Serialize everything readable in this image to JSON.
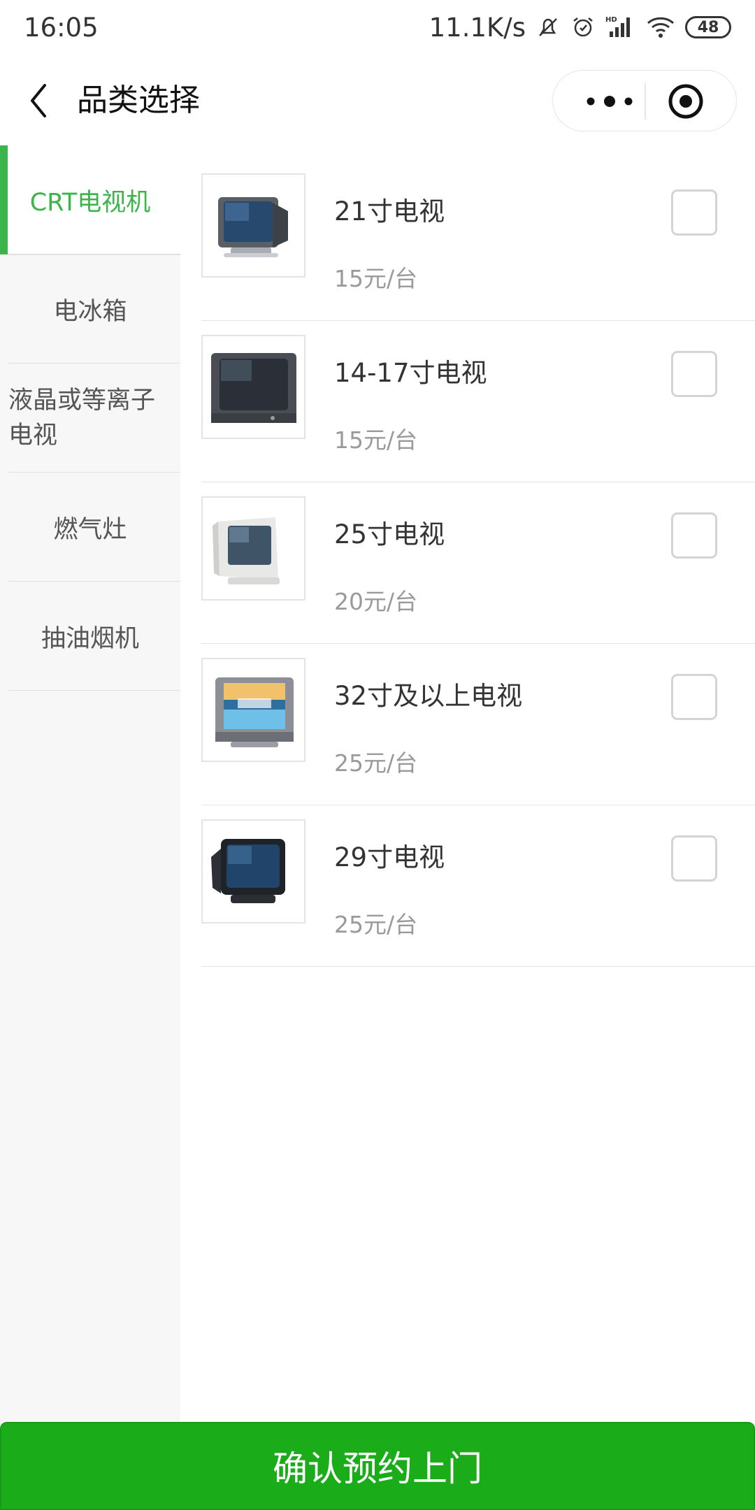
{
  "status_bar": {
    "time": "16:05",
    "network_speed": "11.1K/s",
    "battery": "48",
    "icons": [
      "bell-muted-icon",
      "alarm-icon",
      "hd-signal-icon",
      "wifi-icon",
      "battery-icon"
    ]
  },
  "nav": {
    "title": "品类选择",
    "icons": [
      "back-arrow-icon",
      "more-dots-icon",
      "target-icon"
    ]
  },
  "sidebar": {
    "items": [
      {
        "label": "CRT电视机",
        "active": true
      },
      {
        "label": "电冰箱",
        "active": false
      },
      {
        "label": "液晶或等离子电视",
        "active": false
      },
      {
        "label": "燃气灶",
        "active": false
      },
      {
        "label": "抽油烟机",
        "active": false
      }
    ]
  },
  "products": [
    {
      "name": "21寸电视",
      "price": "15元/台",
      "checked": false,
      "image_icon": "crt-tv-image"
    },
    {
      "name": "14-17寸电视",
      "price": "15元/台",
      "checked": false,
      "image_icon": "crt-tv-image"
    },
    {
      "name": "25寸电视",
      "price": "20元/台",
      "checked": false,
      "image_icon": "crt-tv-image"
    },
    {
      "name": "32寸及以上电视",
      "price": "25元/台",
      "checked": false,
      "image_icon": "crt-tv-image"
    },
    {
      "name": "29寸电视",
      "price": "25元/台",
      "checked": false,
      "image_icon": "crt-tv-image"
    }
  ],
  "confirm_button": {
    "label": "确认预约上门"
  },
  "colors": {
    "accent": "#3bb54a",
    "button": "#1aad19"
  }
}
